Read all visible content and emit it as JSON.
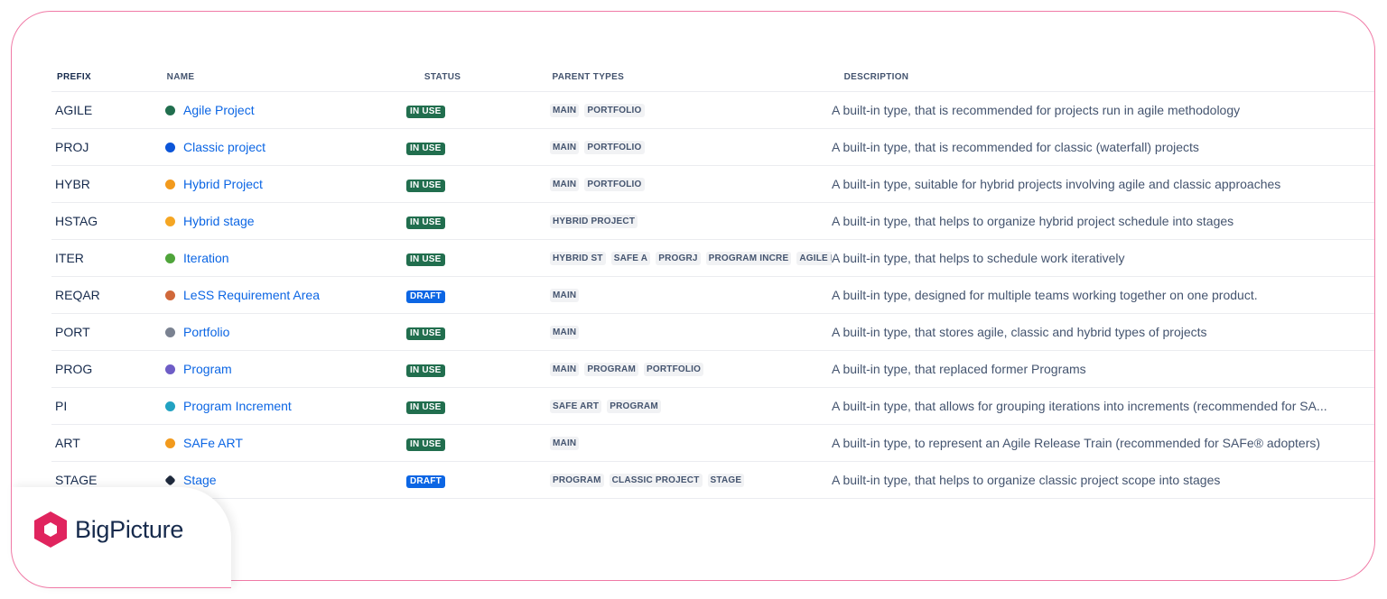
{
  "columns": {
    "prefix": "PREFIX",
    "name": "NAME",
    "status": "STATUS",
    "parent_types": "PARENT TYPES",
    "description": "DESCRIPTION"
  },
  "rows": [
    {
      "prefix": "AGILE",
      "name": "Agile Project",
      "color": "#216e4e",
      "status": "IN USE",
      "parents": [
        "MAIN",
        "PORTFOLIO"
      ],
      "description": "A built-in type, that is recommended for projects run in agile methodology"
    },
    {
      "prefix": "PROJ",
      "name": "Classic project",
      "color": "#0c55d8",
      "status": "IN USE",
      "parents": [
        "MAIN",
        "PORTFOLIO"
      ],
      "description": "A built-in type, that is recommended for classic (waterfall) projects"
    },
    {
      "prefix": "HYBR",
      "name": "Hybrid Project",
      "color": "#f29a1d",
      "status": "IN USE",
      "parents": [
        "MAIN",
        "PORTFOLIO"
      ],
      "description": "A built-in type, suitable for hybrid projects involving agile and classic approaches"
    },
    {
      "prefix": "HSTAG",
      "name": "Hybrid stage",
      "color": "#f5a623",
      "status": "IN USE",
      "parents": [
        "HYBRID PROJECT"
      ],
      "description": "A built-in type, that helps to organize hybrid project schedule into stages"
    },
    {
      "prefix": "ITER",
      "name": "Iteration",
      "color": "#4fa43a",
      "status": "IN USE",
      "parents": [
        "HYBRID ST",
        "SAFE A",
        "PROGRJ",
        "PROGRAM INCRE",
        "AGILE PROJ"
      ],
      "description": "A built-in type, that helps to schedule work iteratively"
    },
    {
      "prefix": "REQAR",
      "name": "LeSS Requirement Area",
      "color": "#d0683a",
      "status": "DRAFT",
      "parents": [
        "MAIN"
      ],
      "description": "A built-in type, designed for multiple teams working together on one product."
    },
    {
      "prefix": "PORT",
      "name": "Portfolio",
      "color": "#7a8291",
      "status": "IN USE",
      "parents": [
        "MAIN"
      ],
      "description": "A built-in type, that stores agile, classic and hybrid types of projects"
    },
    {
      "prefix": "PROG",
      "name": "Program",
      "color": "#6e5dc6",
      "status": "IN USE",
      "parents": [
        "MAIN",
        "PROGRAM",
        "PORTFOLIO"
      ],
      "description": "A built-in type, that replaced former Programs"
    },
    {
      "prefix": "PI",
      "name": "Program Increment",
      "color": "#22a2c2",
      "status": "IN USE",
      "parents": [
        "SAFE ART",
        "PROGRAM"
      ],
      "description": "A built-in type, that allows for grouping iterations into increments (recommended for SA..."
    },
    {
      "prefix": "ART",
      "name": "SAFe ART",
      "color": "#f29a1d",
      "status": "IN USE",
      "parents": [
        "MAIN"
      ],
      "description": "A built-in type, to represent an Agile Release Train (recommended for SAFe® adopters)"
    },
    {
      "prefix": "STAGE",
      "name": "Stage",
      "color": "#1f2a3d",
      "status": "DRAFT",
      "parents": [
        "PROGRAM",
        "CLASSIC PROJECT",
        "STAGE"
      ],
      "description": "A built-in type, that helps to organize classic project scope into stages"
    }
  ],
  "colors": {
    "in_use": "#216e4e",
    "draft": "#0c66e4",
    "brand": "#e0245e",
    "frame": "#f07aa6"
  },
  "logo": {
    "text": "BigPicture",
    "icon": "hexagon-logo-icon"
  }
}
